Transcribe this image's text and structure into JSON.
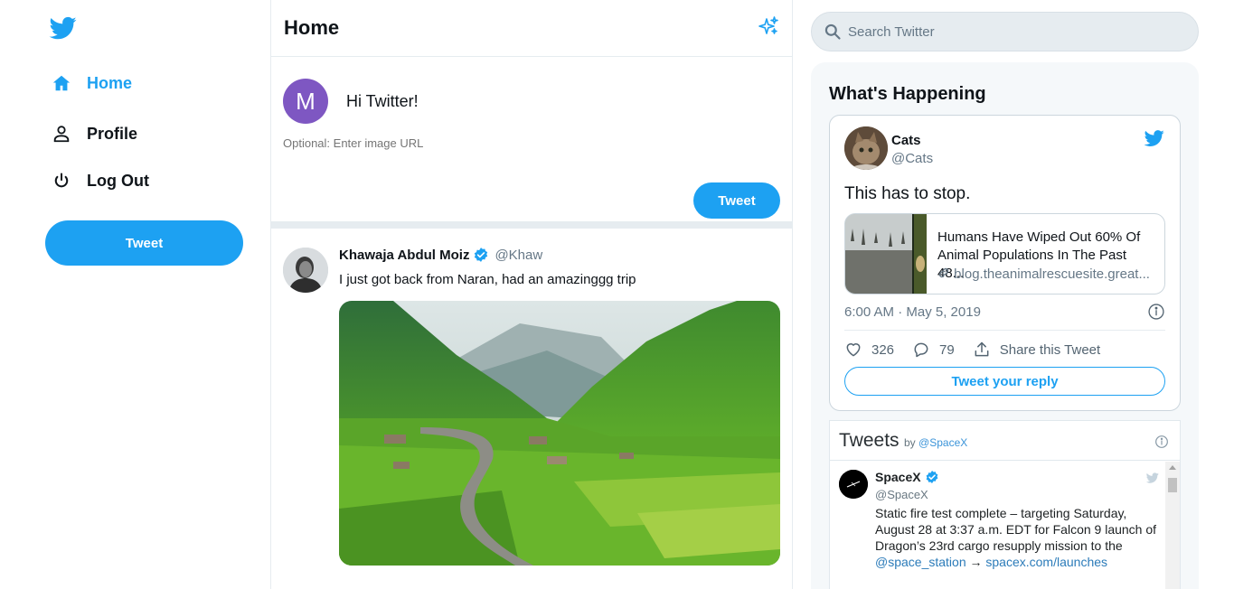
{
  "sidebar": {
    "logo": "twitter-bird-icon",
    "items": [
      {
        "label": "Home",
        "icon": "home-icon",
        "active": true
      },
      {
        "label": "Profile",
        "icon": "person-icon"
      },
      {
        "label": "Log Out",
        "icon": "power-icon"
      }
    ],
    "tweet_button": "Tweet"
  },
  "feed": {
    "title": "Home",
    "header_icon": "sparkle-icon",
    "composer": {
      "avatar_letter": "M",
      "text": "Hi Twitter!",
      "image_placeholder": "Optional: Enter image URL",
      "submit_label": "Tweet"
    },
    "post": {
      "name": "Khawaja Abdul Moiz",
      "handle": "@Khaw",
      "text": "I just got back from Naran, had an amazinggg trip"
    }
  },
  "search": {
    "placeholder": "Search Twitter"
  },
  "happening": {
    "title": "What's Happening",
    "embed": {
      "name": "Cats",
      "handle": "@Cats",
      "text": "This has to stop.",
      "card_title": "Humans Have Wiped Out 60% Of Animal Populations In The Past 48...",
      "card_link": "blog.theanimalrescuesite.great...",
      "time": "6:00 AM · May 5, 2019",
      "likes": "326",
      "replies": "79",
      "share_label": "Share this Tweet",
      "reply_label": "Tweet your reply"
    },
    "timeline": {
      "title": "Tweets",
      "by": "by",
      "by_handle": "@SpaceX",
      "tweet": {
        "name": "SpaceX",
        "handle": "@SpaceX",
        "text": "Static fire test complete – targeting Saturday, August 28 at 3:37 a.m. EDT for Falcon 9 launch of Dragon’s 23rd cargo resupply mission to the",
        "mention": "@space_station",
        "arrow": "→",
        "link": "spacex.com/launches"
      }
    }
  },
  "colors": {
    "accent": "#1da1f2",
    "avatar_purple": "#7e57c2",
    "border": "#e6ecf0"
  }
}
